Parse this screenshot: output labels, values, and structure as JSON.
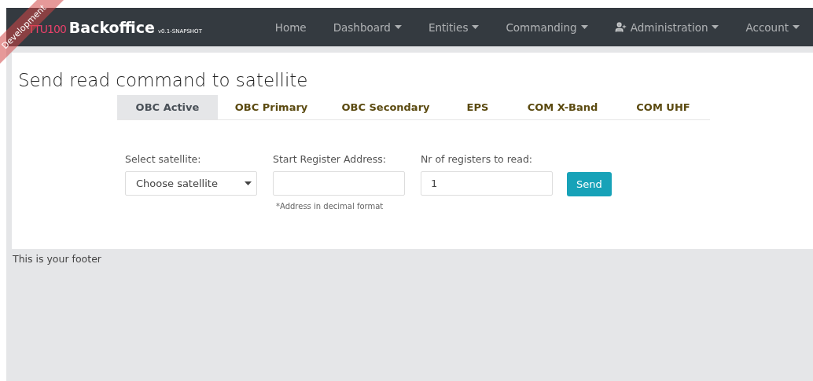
{
  "brand": {
    "logo": "TTU100",
    "name": "Backoffice",
    "version": "v0.1-SNAPSHOT"
  },
  "ribbon": "Development",
  "nav": [
    {
      "label": "Home",
      "kind": "link"
    },
    {
      "label": "Dashboard",
      "kind": "menu"
    },
    {
      "label": "Entities",
      "kind": "menu"
    },
    {
      "label": "Commanding",
      "kind": "menu"
    },
    {
      "label": "Administration",
      "kind": "user-menu"
    },
    {
      "label": "Account",
      "kind": "menu"
    }
  ],
  "title": "Send read command to satellite",
  "tabs": [
    {
      "label": "OBC Active",
      "selected": true
    },
    {
      "label": "OBC Primary",
      "selected": false
    },
    {
      "label": "OBC Secondary",
      "selected": false
    },
    {
      "label": "EPS",
      "selected": false
    },
    {
      "label": "COM X-Band",
      "selected": false
    },
    {
      "label": "COM UHF",
      "selected": false
    }
  ],
  "form": {
    "satellite": {
      "label": "Select satellite:",
      "value": "Choose satellite"
    },
    "address": {
      "label": "Start Register Address:",
      "hint": "*Address in decimal format"
    },
    "count": {
      "label": "Nr of registers to read:",
      "value": "1"
    },
    "button": "Send"
  },
  "footer": "This is your footer"
}
